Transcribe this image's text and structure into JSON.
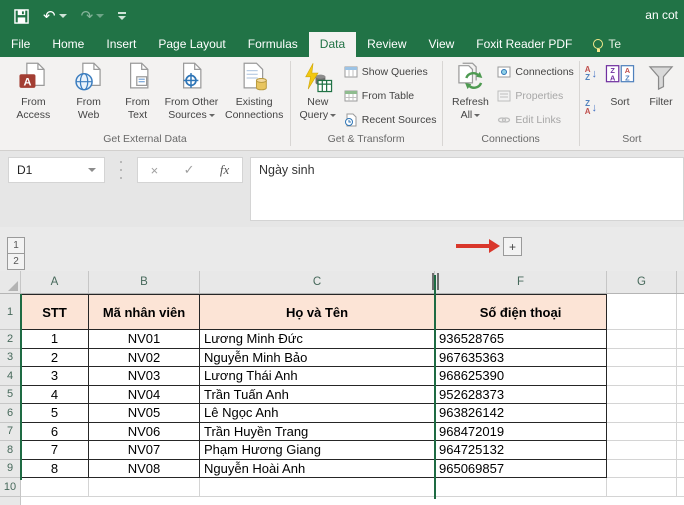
{
  "app": {
    "title_fragment": "an cot"
  },
  "tabs": {
    "items": [
      "File",
      "Home",
      "Insert",
      "Page Layout",
      "Formulas",
      "Data",
      "Review",
      "View",
      "Foxit Reader PDF"
    ],
    "active": "Data",
    "tell_me": "Te"
  },
  "ribbon": {
    "groups": [
      {
        "label": "Get External Data"
      },
      {
        "label": "Get & Transform"
      },
      {
        "label": "Connections"
      },
      {
        "label": "Sort"
      }
    ],
    "buttons": {
      "from_access": "From Access",
      "from_web": "From Web",
      "from_text": "From Text",
      "from_other_sources": "From Other Sources",
      "existing_connections": "Existing Connections",
      "new_query": "New Query",
      "show_queries": "Show Queries",
      "from_table": "From Table",
      "recent_sources": "Recent Sources",
      "refresh_all": "Refresh All",
      "connections": "Connections",
      "properties": "Properties",
      "edit_links": "Edit Links",
      "sort": "Sort",
      "filter": "Filter"
    }
  },
  "formula_bar": {
    "name_box": "D1",
    "value": "Ngày sinh"
  },
  "icons": {
    "cancel": "×",
    "enter": "✓",
    "fx": "fx",
    "undo": "↶",
    "redo": "↷",
    "access_letter": "A",
    "sort_a": "A",
    "sort_z": "Z",
    "sort_arrow": "↓"
  },
  "outline": {
    "level1": "1",
    "level2": "2",
    "expand": "+"
  },
  "grid": {
    "column_headers": [
      "A",
      "B",
      "C",
      "F",
      "G"
    ],
    "row_headers": [
      "1",
      "2",
      "3",
      "4",
      "5",
      "6",
      "7",
      "8",
      "9",
      "10"
    ],
    "table": {
      "headers": [
        "STT",
        "Mã nhân viên",
        "Họ và Tên",
        "Số điện thoại"
      ],
      "rows": [
        [
          "1",
          "NV01",
          "Lương Minh Đức",
          "936528765"
        ],
        [
          "2",
          "NV02",
          "Nguyễn Minh Bảo",
          "967635363"
        ],
        [
          "3",
          "NV03",
          "Lương Thái Anh",
          "968625390"
        ],
        [
          "4",
          "NV04",
          "Trần Tuấn Anh",
          "952628373"
        ],
        [
          "5",
          "NV05",
          "Lê Ngọc Anh",
          "963826142"
        ],
        [
          "6",
          "NV06",
          "Trần Huyền Trang",
          "968472019"
        ],
        [
          "7",
          "NV07",
          "Phạm Hương Giang",
          "964725132"
        ],
        [
          "8",
          "NV08",
          "Nguyễn Hoài Anh",
          "965069857"
        ]
      ]
    }
  },
  "colors": {
    "titlebar_green": "#217346",
    "header_fill": "#FCE4D6",
    "hidden_column_line": "#1E6B43",
    "annotation_arrow": "#D9372B"
  }
}
